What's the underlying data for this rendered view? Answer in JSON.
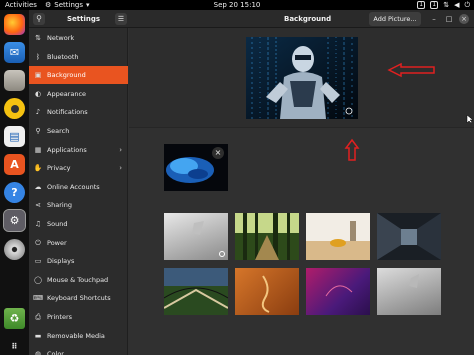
{
  "topbar": {
    "activities": "Activities",
    "app_menu": "Settings",
    "clock": "Sep 20  15:10",
    "tray_icon_1": "1",
    "tray_icon_2": "1"
  },
  "dock": {
    "items": [
      "firefox-icon",
      "mail-icon",
      "files-icon",
      "rhythmbox-icon",
      "writer-icon",
      "software-icon",
      "help-icon",
      "settings-icon",
      "disc-icon",
      "trash-icon",
      "apps-grid-icon"
    ]
  },
  "window": {
    "sidebar_title": "Settings",
    "page_title": "Background",
    "add_picture_label": "Add Picture..."
  },
  "sidebar": {
    "items": [
      {
        "label": "Network",
        "icon": "network-icon",
        "glyph": "⇅",
        "chevron": ""
      },
      {
        "label": "Bluetooth",
        "icon": "bluetooth-icon",
        "glyph": "ᛒ",
        "chevron": ""
      },
      {
        "label": "Background",
        "icon": "background-icon",
        "glyph": "▣",
        "chevron": ""
      },
      {
        "label": "Appearance",
        "icon": "appearance-icon",
        "glyph": "◐",
        "chevron": ""
      },
      {
        "label": "Notifications",
        "icon": "bell-icon",
        "glyph": "♪",
        "chevron": ""
      },
      {
        "label": "Search",
        "icon": "search-icon",
        "glyph": "⚲",
        "chevron": ""
      },
      {
        "label": "Applications",
        "icon": "applications-icon",
        "glyph": "▦",
        "chevron": "›"
      },
      {
        "label": "Privacy",
        "icon": "privacy-icon",
        "glyph": "✋",
        "chevron": "›"
      },
      {
        "label": "Online Accounts",
        "icon": "cloud-icon",
        "glyph": "☁",
        "chevron": ""
      },
      {
        "label": "Sharing",
        "icon": "sharing-icon",
        "glyph": "⋖",
        "chevron": ""
      },
      {
        "label": "Sound",
        "icon": "sound-icon",
        "glyph": "♫",
        "chevron": ""
      },
      {
        "label": "Power",
        "icon": "power-icon",
        "glyph": "⏻",
        "chevron": ""
      },
      {
        "label": "Displays",
        "icon": "display-icon",
        "glyph": "▭",
        "chevron": ""
      },
      {
        "label": "Mouse & Touchpad",
        "icon": "mouse-icon",
        "glyph": "◯",
        "chevron": ""
      },
      {
        "label": "Keyboard Shortcuts",
        "icon": "keyboard-icon",
        "glyph": "⌨",
        "chevron": ""
      },
      {
        "label": "Printers",
        "icon": "printer-icon",
        "glyph": "⎙",
        "chevron": ""
      },
      {
        "label": "Removable Media",
        "icon": "removable-media-icon",
        "glyph": "▬",
        "chevron": ""
      },
      {
        "label": "Color",
        "icon": "color-icon",
        "glyph": "◍",
        "chevron": ""
      }
    ]
  },
  "colors": {
    "accent": "#e95420",
    "annotation": "#e02020"
  }
}
